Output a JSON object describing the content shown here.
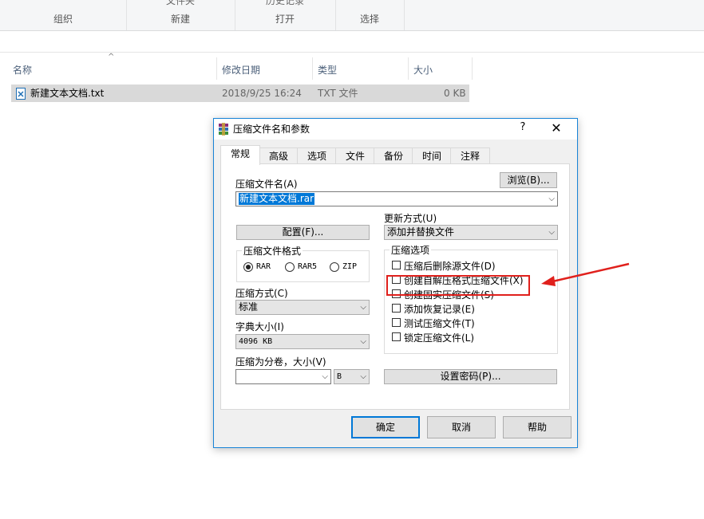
{
  "ribbon": {
    "groups": [
      {
        "label": "组织",
        "cut_text": ""
      },
      {
        "label": "新建",
        "cut_text": "文件夹"
      },
      {
        "label": "打开",
        "cut_text": "历史记录"
      },
      {
        "label": "选择",
        "cut_text": ""
      }
    ]
  },
  "list": {
    "columns": {
      "name": "名称",
      "date": "修改日期",
      "type": "类型",
      "size": "大小"
    },
    "rows": [
      {
        "name": "新建文本文档.txt",
        "date": "2018/9/25 16:24",
        "type": "TXT 文件",
        "size": "0 KB"
      }
    ]
  },
  "dialog": {
    "title": "压缩文件名和参数",
    "help": "?",
    "close": "✕",
    "tabs": [
      "常规",
      "高级",
      "选项",
      "文件",
      "备份",
      "时间",
      "注释"
    ],
    "archive_name_label": "压缩文件名(A)",
    "archive_name_value": "新建文本文档.rar",
    "browse_button": "浏览(B)...",
    "update_mode_label": "更新方式(U)",
    "update_mode_value": "添加并替换文件",
    "profile_button": "配置(F)...",
    "format_label": "压缩文件格式",
    "formats": [
      "RAR",
      "RAR5",
      "ZIP"
    ],
    "selected_format": "RAR",
    "options_label": "压缩选项",
    "options": [
      "压缩后删除源文件(D)",
      "创建自解压格式压缩文件(X)",
      "创建固实压缩文件(S)",
      "添加恢复记录(E)",
      "测试压缩文件(T)",
      "锁定压缩文件(L)"
    ],
    "method_label": "压缩方式(C)",
    "method_value": "标准",
    "dict_label": "字典大小(I)",
    "dict_value": "4096 KB",
    "split_label": "压缩为分卷，大小(V)",
    "split_value": "",
    "split_unit": "B",
    "password_button": "设置密码(P)...",
    "ok_button": "确定",
    "cancel_button": "取消",
    "help_button": "帮助"
  },
  "colors": {
    "highlight_box": "#e0201c",
    "arrow": "#e0201c",
    "dialog_border": "#1883d7",
    "selection": "#0078d7"
  }
}
